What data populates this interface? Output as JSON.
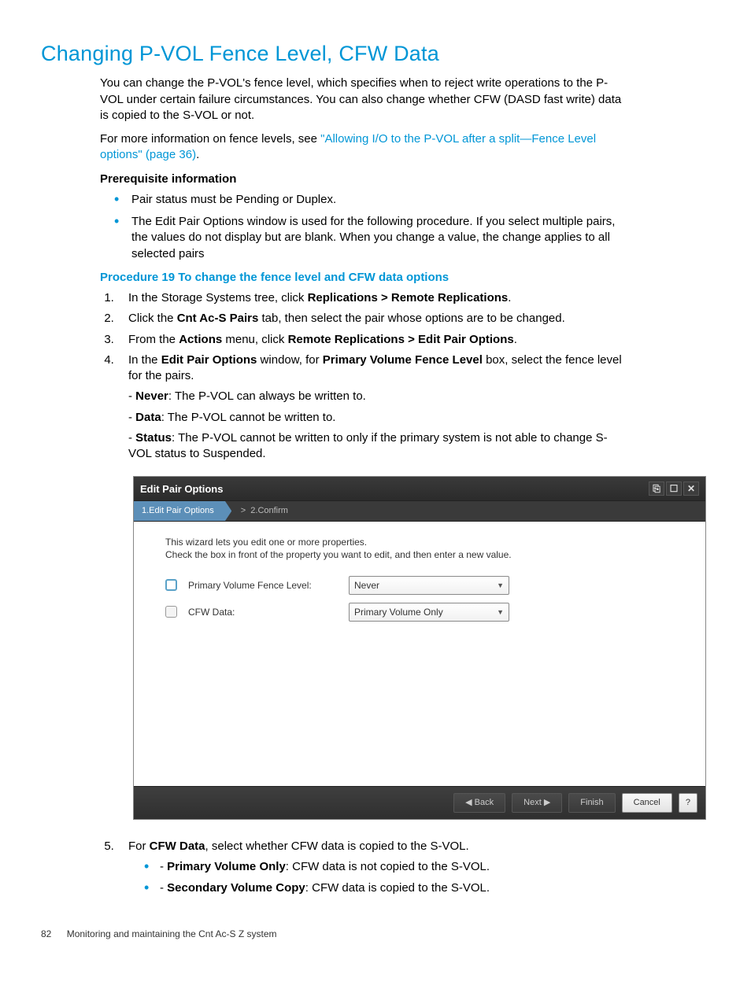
{
  "heading": "Changing P-VOL Fence Level, CFW Data",
  "intro": {
    "p1": "You can change the P-VOL's fence level, which specifies when to reject write operations to the P-VOL under certain failure circumstances. You can also change whether CFW (DASD fast write) data is copied to the S-VOL or not.",
    "p2a": "For more information on fence levels, see ",
    "p2link": "\"Allowing I/O to the P-VOL after a split—Fence Level options\" (page 36)",
    "p2b": "."
  },
  "prereq": {
    "title": "Prerequisite information",
    "items": [
      "Pair status must be Pending or Duplex.",
      "The Edit Pair Options window is used for the following procedure. If you select multiple pairs, the values do not display but are blank. When you change a value, the change applies to all selected pairs"
    ]
  },
  "procedure": {
    "title": "Procedure 19 To change the fence level and CFW data options",
    "step1a": "In the Storage Systems tree, click ",
    "step1b": "Replications > Remote Replications",
    "step1c": ".",
    "step2a": "Click the ",
    "step2b": "Cnt Ac-S Pairs",
    "step2c": " tab, then select the pair whose options are to be changed.",
    "step3a": "From the ",
    "step3b": "Actions",
    "step3c": " menu, click ",
    "step3d": "Remote Replications > Edit Pair Options",
    "step3e": ".",
    "step4a": "In the ",
    "step4b": "Edit Pair Options",
    "step4c": " window, for ",
    "step4d": "Primary Volume Fence Level",
    "step4e": " box, select the fence level for the pairs.",
    "step4_never_label": "Never",
    "step4_never_text": ": The P-VOL can always be written to.",
    "step4_data_label": "Data",
    "step4_data_text": ": The P-VOL cannot be written to.",
    "step4_status_label": "Status",
    "step4_status_text": ": The P-VOL cannot be written to only if the primary system is not able to change S-VOL status to Suspended.",
    "step5a": "For ",
    "step5b": "CFW Data",
    "step5c": ", select whether CFW data is copied to the S-VOL.",
    "step5_pv_label": "Primary Volume Only",
    "step5_pv_text": ": CFW data is not copied to the S-VOL.",
    "step5_sv_label": "Secondary Volume Copy",
    "step5_sv_text": ": CFW data is copied to the S-VOL."
  },
  "dialog": {
    "title": "Edit Pair Options",
    "steps": {
      "s1": "1.Edit Pair Options",
      "s2": "2.Confirm"
    },
    "intro1": "This wizard lets you edit one or more properties.",
    "intro2": "Check the box in front of the property you want to edit, and then enter a new value.",
    "row1_label": "Primary Volume Fence Level:",
    "row1_value": "Never",
    "row2_label": "CFW Data:",
    "row2_value": "Primary Volume Only",
    "buttons": {
      "back": "◀ Back",
      "next": "Next ▶",
      "finish": "Finish",
      "cancel": "Cancel",
      "help": "?"
    }
  },
  "footer": {
    "page": "82",
    "text": "Monitoring and maintaining the Cnt Ac-S Z system"
  }
}
